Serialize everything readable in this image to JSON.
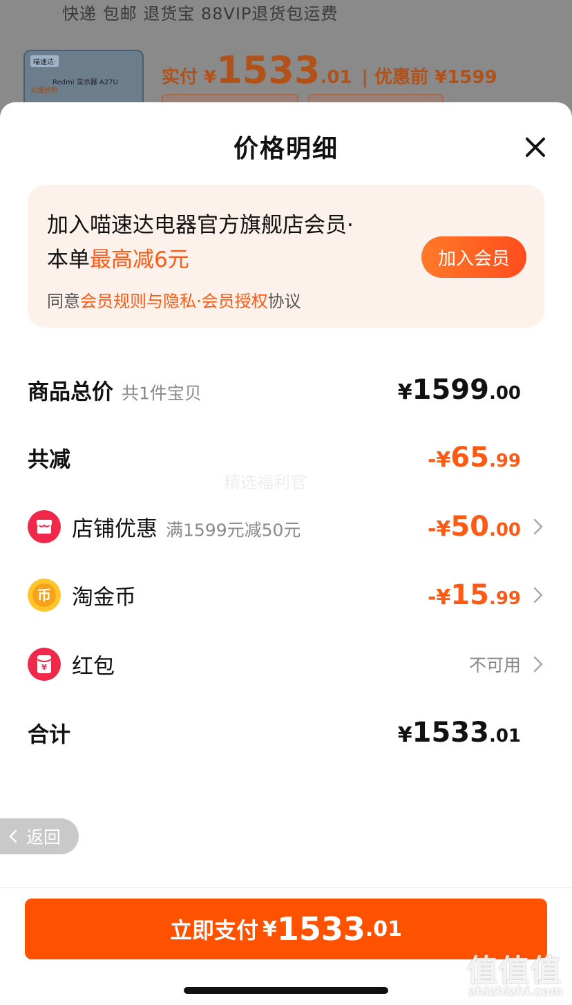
{
  "background": {
    "services": "快递 包邮 退货宝 88VIP退货包运费",
    "thumb_tag": "喵速达·",
    "thumb_model": "Redmi 显示器 A27U",
    "thumb_hot": "火爆抢购",
    "paid_label": "实付 ¥",
    "paid_int": "1533",
    "paid_dec": ".01",
    "before_label": "| 优惠前 ¥1599"
  },
  "sheet": {
    "title": "价格明细",
    "close_icon": "close-icon"
  },
  "member_card": {
    "line1": "加入喵速达电器官方旗舰店会员·",
    "line2_prefix": "本单",
    "line2_highlight": "最高减6元",
    "join_button": "加入会员",
    "agree_prefix": "同意",
    "agree_link1": "会员规则与隐私",
    "agree_sep": "·",
    "agree_link2": "会员授权",
    "agree_suffix": "协议"
  },
  "rows": {
    "total": {
      "label": "商品总价",
      "sub": "共1件宝贝",
      "sym": "¥",
      "int": "1599",
      "dec": ".00"
    },
    "reduce": {
      "label": "共减",
      "sym": "-¥",
      "int": "65",
      "dec": ".99"
    },
    "shop": {
      "label": "店铺优惠",
      "sub": "满1599元减50元",
      "sym": "-¥",
      "int": "50",
      "dec": ".00",
      "icon": "shop-icon"
    },
    "coin": {
      "label": "淘金币",
      "sym": "-¥",
      "int": "15",
      "dec": ".99",
      "icon": "coin-icon"
    },
    "redpacket": {
      "label": "红包",
      "status": "不可用",
      "icon": "red-packet-icon"
    },
    "sum": {
      "label": "合计",
      "sym": "¥",
      "int": "1533",
      "dec": ".01"
    }
  },
  "watermark": "精选福利官",
  "back_button": "返回",
  "pay_button": {
    "label": "立即支付",
    "sym": "¥",
    "int": "1533",
    "dec": ".01"
  },
  "site_mark": "值值值",
  "site_url": "zhizhizhi.com",
  "colors": {
    "accent": "#ff5200",
    "highlight": "#ff5a14",
    "card_bg": "#fdf1ec"
  }
}
